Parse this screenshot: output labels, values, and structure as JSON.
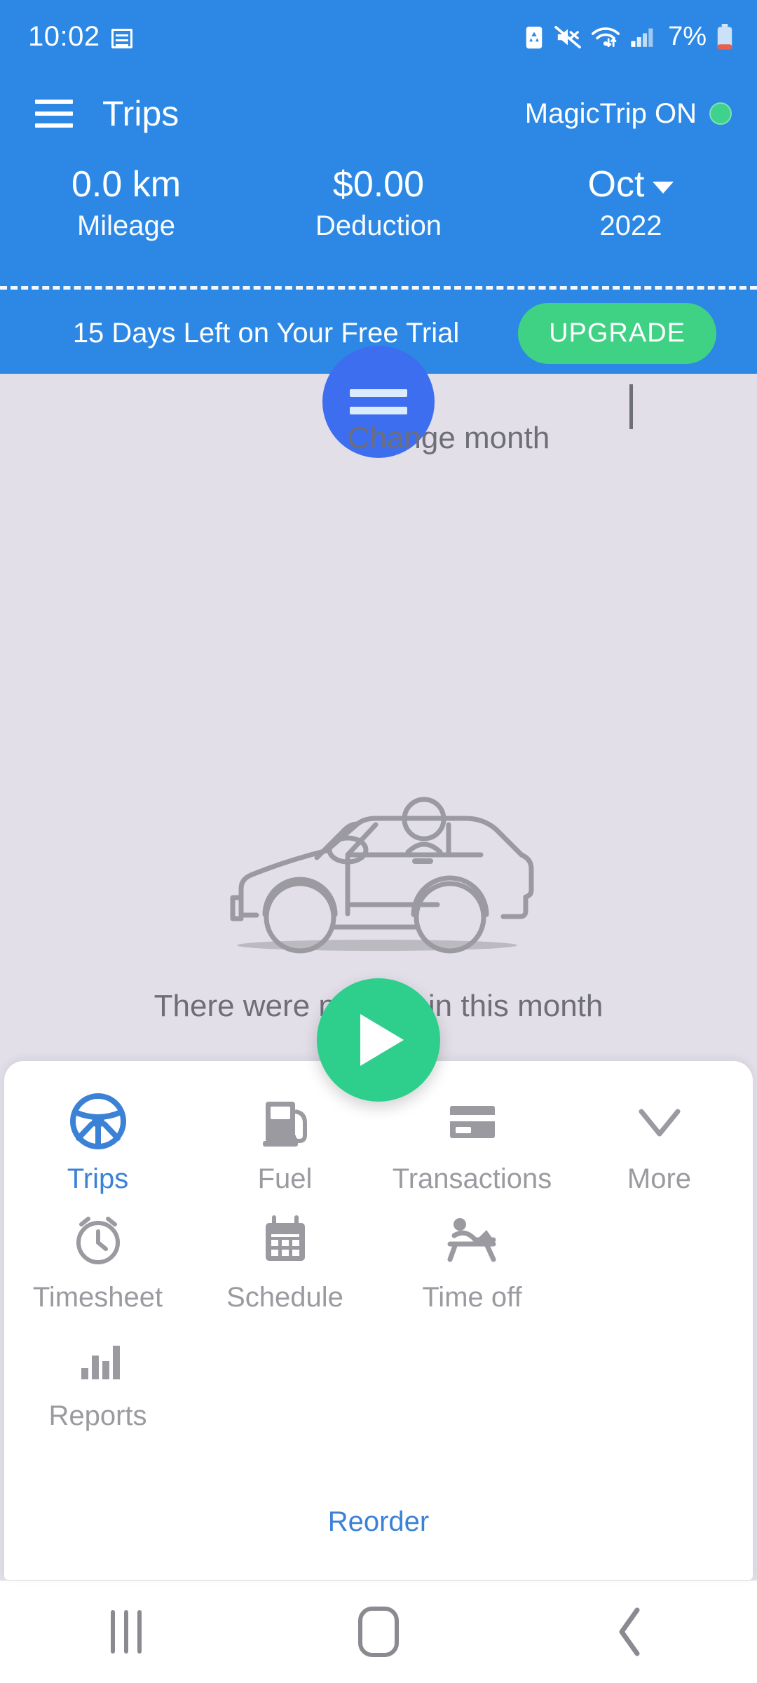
{
  "status_bar": {
    "time": "10:02",
    "battery_percent": "7%",
    "icons": [
      "note-icon",
      "battery-saver-icon",
      "mute-icon",
      "wifi-icon",
      "signal-icon",
      "battery-low-icon"
    ]
  },
  "header": {
    "menu_icon": "hamburger-menu-icon",
    "title": "Trips",
    "magic_trip_label": "MagicTrip ON",
    "magic_trip_status": "on",
    "accent_blue": "#2C88E4",
    "accent_green": "#3FD285",
    "stats": [
      {
        "value": "0.0 km",
        "label": "Mileage",
        "has_caret": false
      },
      {
        "value": "$0.00",
        "label": "Deduction",
        "has_caret": false
      },
      {
        "value": "Oct",
        "label": "2022",
        "has_caret": true
      }
    ],
    "trial": {
      "message": "15 Days Left on Your Free Trial",
      "upgrade_label": "UPGRADE"
    }
  },
  "coach_marks": {
    "drag_handle_icon": "drag-handle-icon",
    "change_month_label": "Change month"
  },
  "empty_state": {
    "illustration": "car-illustration",
    "message": "There were no trips in this month"
  },
  "fab": {
    "icon": "play-icon",
    "color": "#2ECE8D"
  },
  "bottom_sheet": {
    "items": [
      {
        "label": "Trips",
        "icon": "steering-wheel-icon",
        "active": true
      },
      {
        "label": "Fuel",
        "icon": "fuel-pump-icon",
        "active": false
      },
      {
        "label": "Transactions",
        "icon": "credit-card-icon",
        "active": false
      },
      {
        "label": "More",
        "icon": "chevron-down-icon",
        "active": false
      },
      {
        "label": "Timesheet",
        "icon": "alarm-clock-icon",
        "active": false
      },
      {
        "label": "Schedule",
        "icon": "calendar-icon",
        "active": false
      },
      {
        "label": "Time off",
        "icon": "lounge-chair-icon",
        "active": false
      },
      {
        "label": "Reports",
        "icon": "bar-chart-icon",
        "active": false
      }
    ],
    "reorder_label": "Reorder"
  },
  "nav_bar": {
    "recents_icon": "recents-icon",
    "home_icon": "home-icon",
    "back_icon": "back-icon"
  }
}
